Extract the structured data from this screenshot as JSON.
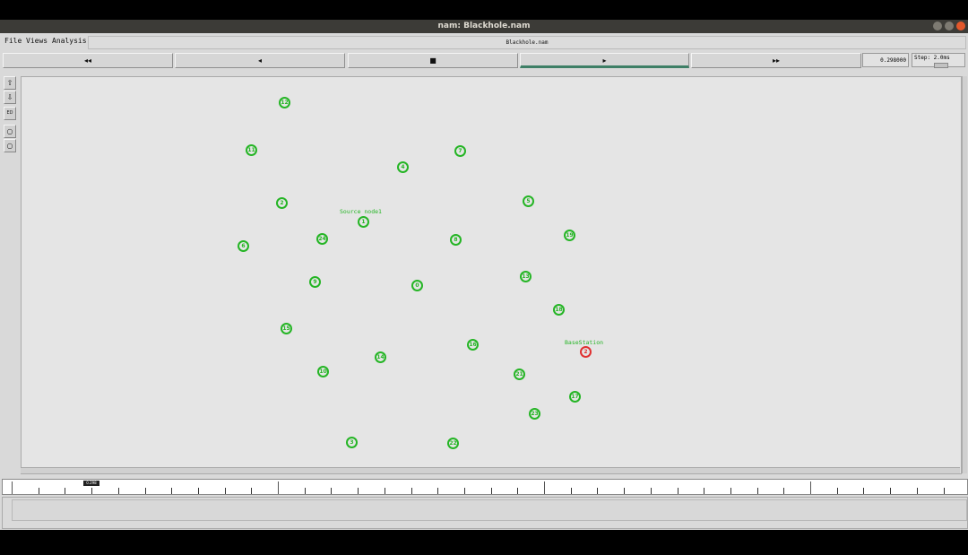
{
  "window": {
    "title": "nam: Blackhole.nam"
  },
  "menu": {
    "file": "File",
    "views": "Views",
    "analysis": "Analysis",
    "filename": "Blackhole.nam"
  },
  "controls": {
    "rewind": "◂◂",
    "back": "◂",
    "stop": "■",
    "play": "▸",
    "fastforward": "▸▸",
    "time": "0.298000",
    "step": "Step: 2.0ms"
  },
  "tools": {
    "zoom_in": "⇧",
    "zoom_out": "⇩",
    "edit": "ED",
    "circle1": "○",
    "circle2": "○"
  },
  "nodes": [
    {
      "id": "12",
      "label": ""
    },
    {
      "id": "11",
      "label": ""
    },
    {
      "id": "7",
      "label": ""
    },
    {
      "id": "4",
      "label": ""
    },
    {
      "id": "2",
      "label": ""
    },
    {
      "id": "5",
      "label": ""
    },
    {
      "id": "1",
      "label": "Source node1"
    },
    {
      "id": "6",
      "label": ""
    },
    {
      "id": "24",
      "label": ""
    },
    {
      "id": "8",
      "label": ""
    },
    {
      "id": "19",
      "label": ""
    },
    {
      "id": "9",
      "label": ""
    },
    {
      "id": "0",
      "label": ""
    },
    {
      "id": "13",
      "label": ""
    },
    {
      "id": "18",
      "label": ""
    },
    {
      "id": "15",
      "label": ""
    },
    {
      "id": "16",
      "label": ""
    },
    {
      "id": "2",
      "label": "BaseStation",
      "status": "red"
    },
    {
      "id": "14",
      "label": ""
    },
    {
      "id": "10",
      "label": ""
    },
    {
      "id": "21",
      "label": ""
    },
    {
      "id": "17",
      "label": ""
    },
    {
      "id": "23",
      "label": ""
    },
    {
      "id": "3",
      "label": ""
    },
    {
      "id": "22",
      "label": ""
    }
  ],
  "timeline": {
    "marker": "0.298"
  },
  "colors": {
    "node": "#25b525",
    "basestation": "#e03030",
    "play_accent": "#3e7f66"
  }
}
